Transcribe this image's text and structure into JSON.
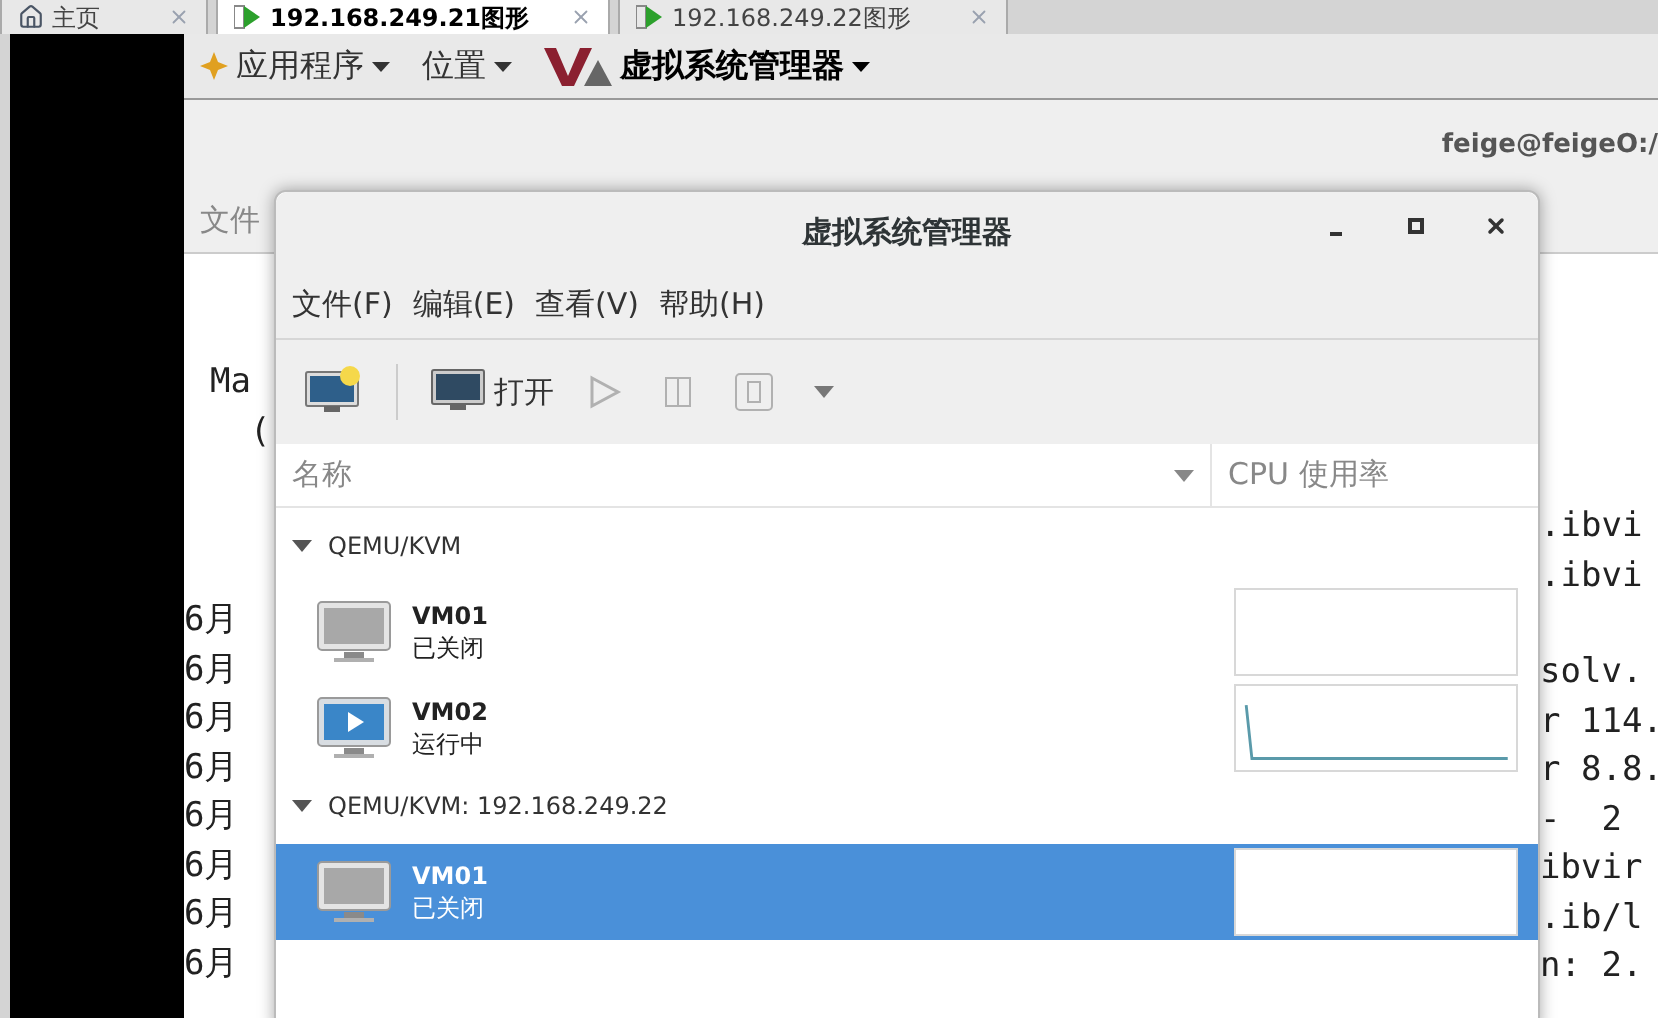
{
  "browser_tabs": [
    {
      "label": "主页",
      "kind": "home",
      "selected": false
    },
    {
      "label": "192.168.249.21图形",
      "kind": "console",
      "selected": true
    },
    {
      "label": "192.168.249.22图形",
      "kind": "console",
      "selected": false
    }
  ],
  "top_bar": {
    "menus": [
      {
        "label": "应用程序",
        "kind": "apps"
      },
      {
        "label": "位置",
        "kind": "places"
      },
      {
        "label": "虚拟系统管理器",
        "kind": "app"
      }
    ]
  },
  "terminal": {
    "title": "feige@feigeO:/",
    "menu": "文件",
    "left_top": [
      "Ma",
      "("
    ],
    "left_bottom": [
      "6月",
      "6月",
      "6月",
      "6月",
      "6月",
      "6月",
      "6月",
      "6月"
    ],
    "right_top": [
      ".ibvi",
      ".ibvi"
    ],
    "right_bottom": [
      "solv.",
      "r 114.",
      "r 8.8.",
      "-  2",
      "ibvir",
      ".ib/l",
      "n: 2."
    ]
  },
  "dialog": {
    "title": "虚拟系统管理器",
    "menu": [
      "文件(F)",
      "编辑(E)",
      "查看(V)",
      "帮助(H)"
    ],
    "toolbar": [
      {
        "kind": "new",
        "disabled": false
      },
      {
        "kind": "open",
        "label": "打开",
        "disabled": false
      },
      {
        "kind": "run",
        "disabled": true
      },
      {
        "kind": "pause",
        "disabled": true
      },
      {
        "kind": "stop",
        "disabled": true
      }
    ],
    "columns": [
      "名称",
      "CPU 使用率"
    ],
    "groups": [
      {
        "name": "QEMU/KVM",
        "expanded": true,
        "children": [
          {
            "name": "VM01",
            "status": "已关闭",
            "running": false,
            "selected": false
          },
          {
            "name": "VM02",
            "status": "运行中",
            "running": true,
            "selected": false
          }
        ]
      },
      {
        "name": "QEMU/KVM: 192.168.249.22",
        "expanded": true,
        "children": [
          {
            "name": "VM01",
            "status": "已关闭",
            "running": false,
            "selected": true
          }
        ]
      }
    ]
  }
}
